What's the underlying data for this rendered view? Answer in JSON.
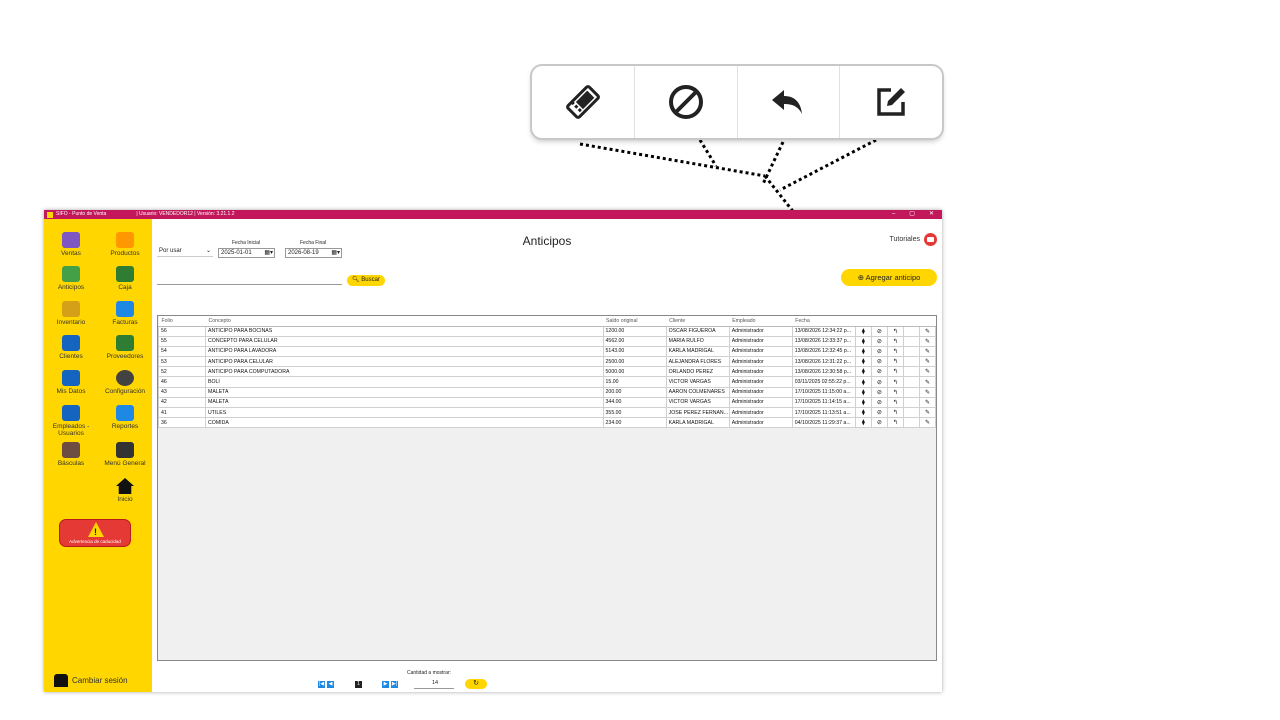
{
  "callout": {
    "buttons": [
      {
        "name": "ticket",
        "icon": "ticket-icon"
      },
      {
        "name": "cancel",
        "icon": "cancel-icon"
      },
      {
        "name": "return",
        "icon": "return-icon"
      },
      {
        "name": "edit",
        "icon": "edit-icon"
      }
    ]
  },
  "window": {
    "app_title": "SIFO - Punto de Venta",
    "user_version": "| Usuario: VENDEDOR12 | Versión: 3.21.1.2",
    "controls": [
      "–",
      "▢",
      "✕"
    ]
  },
  "sidebar": {
    "items": [
      {
        "label": "Ventas",
        "color": "#7e57c2"
      },
      {
        "label": "Productos",
        "color": "#ff9800"
      },
      {
        "label": "Anticipos",
        "color": "#43a047"
      },
      {
        "label": "Caja",
        "color": "#2e7d32"
      },
      {
        "label": "Inventario",
        "color": "#d4a017"
      },
      {
        "label": "Facturas",
        "color": "#1e88e5"
      },
      {
        "label": "Clientes",
        "color": "#1565c0"
      },
      {
        "label": "Proveedores",
        "color": "#2e7d32"
      },
      {
        "label": "Mis Datos",
        "color": "#1565c0"
      },
      {
        "label": "Configuración",
        "color": "#424242"
      },
      {
        "label": "Empleados - Usuarios",
        "color": "#1565c0"
      },
      {
        "label": "Reportes",
        "color": "#1e88e5"
      },
      {
        "label": "Básculas",
        "color": "#6d4c41"
      },
      {
        "label": "Menú General",
        "color": "#333333"
      },
      {
        "label": "Inicio",
        "color": "#111111"
      }
    ],
    "warning": "Advertencia de caducidad",
    "logout": "Cambiar sesión"
  },
  "main": {
    "title": "Anticipos",
    "tutorials": "Tutoriales",
    "filter_select": "Por usar",
    "fecha_inicial_label": "Fecha Inicial",
    "fecha_inicial": "2025-01-01",
    "fecha_final_label": "Fecha Final",
    "fecha_final": "2026-08-19",
    "search_value": "",
    "search_button": "Buscar",
    "add_button": "Agregar anticipo"
  },
  "table": {
    "headers": [
      "Folio",
      "Concepto",
      "Saldo original",
      "Cliente",
      "Empleado",
      "Fecha"
    ],
    "rows": [
      [
        "56",
        "ANTICIPO PARA BOCINAS",
        "1200.00",
        "OSCAR FIGUEROA",
        "Administrador",
        "13/08/2026 12:34:22 p..."
      ],
      [
        "55",
        "CONCEPTO PARA CELULAR",
        "4562.00",
        "MARIA RULFO",
        "Administrador",
        "13/08/2026 12:33:37 p..."
      ],
      [
        "54",
        "ANTICIPO PARA LAVADORA",
        "5143.00",
        "KARLA MADRIGAL",
        "Administrador",
        "13/08/2026 12:32:45 p..."
      ],
      [
        "53",
        "ANTICIPO PARA CELULAR",
        "2500.00",
        "ALEJANDRA FLORES",
        "Administrador",
        "13/08/2026 12:31:22 p..."
      ],
      [
        "52",
        "ANTICIPO PARA COMPUTADORA",
        "5000.00",
        "ORLANDO PEREZ",
        "Administrador",
        "13/08/2026 12:30:58 p..."
      ],
      [
        "46",
        "BOLI",
        "15.00",
        "VICTOR VARGAS",
        "Administrador",
        "03/11/2025 02:55:22 p..."
      ],
      [
        "43",
        "MALETA",
        "200.00",
        "AARON COLMENARES",
        "Administrador",
        "17/10/2025 11:15:00 a..."
      ],
      [
        "42",
        "MALETA",
        "344.00",
        "VICTOR VARGAS",
        "Administrador",
        "17/10/2025 11:14:15 a..."
      ],
      [
        "41",
        "UTILES",
        "355.00",
        "JOSE PEREZ FERNAN...",
        "Administrador",
        "17/10/2025 11:13:51 a..."
      ],
      [
        "36",
        "COMIDA",
        "234.00",
        "KARLA MADRIGAL",
        "Administrador",
        "04/10/2025 11:29:37 a..."
      ]
    ]
  },
  "pager": {
    "label": "Cantidad a mostrar:",
    "count": "14",
    "buttons": [
      "|◀",
      "◀",
      "1",
      "▶",
      "▶|"
    ]
  }
}
